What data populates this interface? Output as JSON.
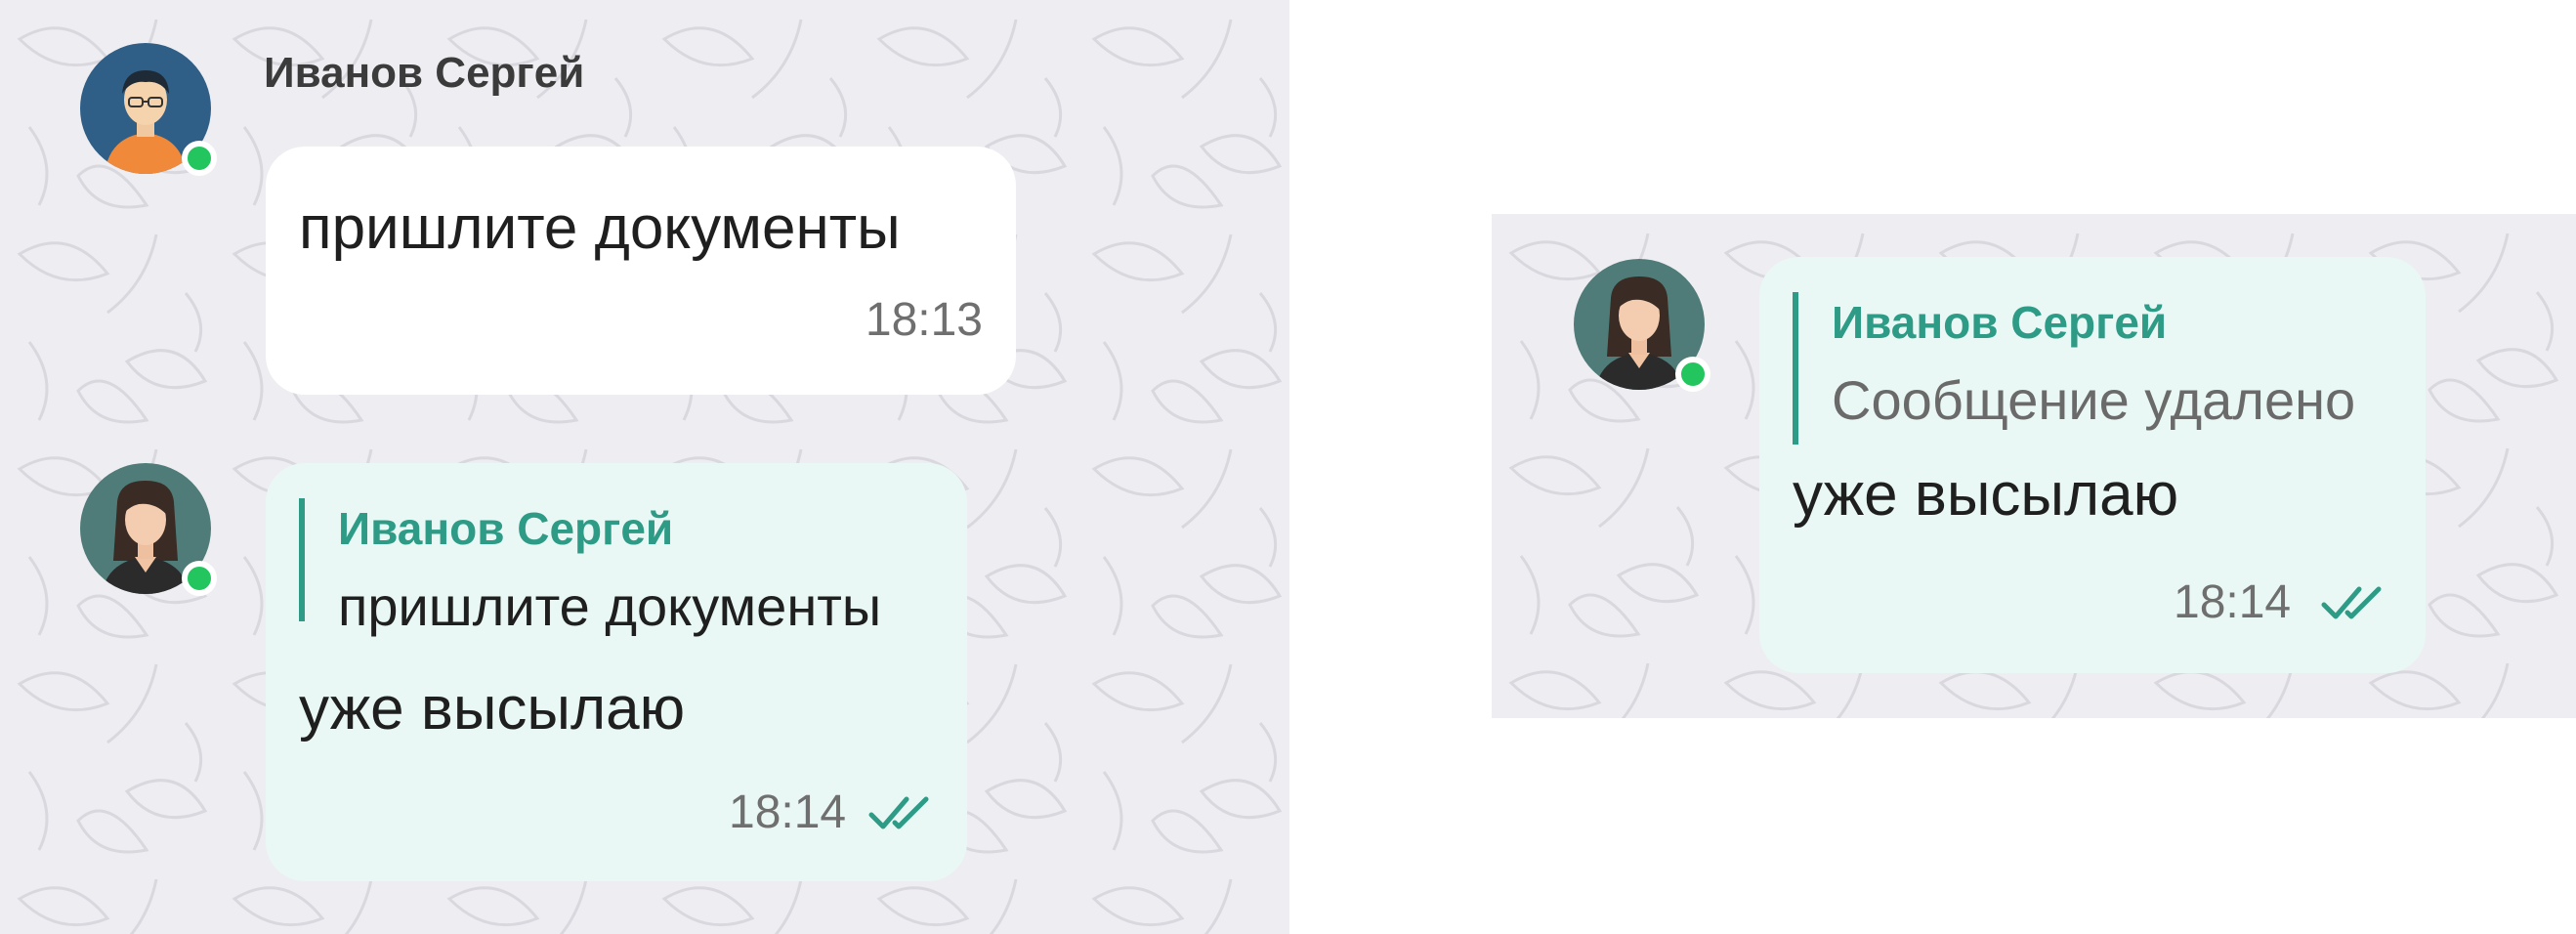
{
  "left_panel": {
    "incoming_message": {
      "sender": "Иванов Сергей",
      "avatar_icon": "male-user-avatar-icon",
      "online": true,
      "text": "пришлите документы",
      "time": "18:13"
    },
    "reply_message": {
      "avatar_icon": "female-user-avatar-icon",
      "online": true,
      "quote": {
        "author": "Иванов Сергей",
        "text": "пришлите документы"
      },
      "text": "уже высылаю",
      "time": "18:14",
      "status_icon": "double-check-icon"
    }
  },
  "right_panel": {
    "reply_message": {
      "avatar_icon": "female-user-avatar-icon",
      "online": true,
      "quote": {
        "author": "Иванов Сергей",
        "text": "Сообщение удалено"
      },
      "text": "уже высылаю",
      "time": "18:14",
      "status_icon": "double-check-icon"
    }
  },
  "colors": {
    "chat_background": "#eeedf1",
    "incoming_bubble": "#ffffff",
    "outgoing_bubble": "#e9f8f4",
    "accent": "#2d9b86",
    "online_indicator": "#22c55e"
  }
}
